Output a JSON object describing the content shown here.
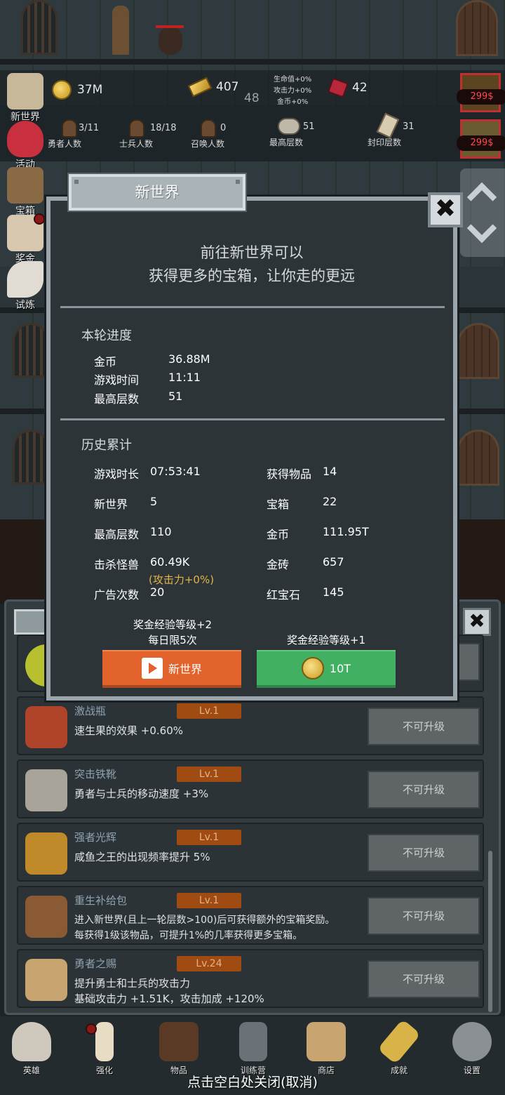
{
  "hud": {
    "gold": "37M",
    "gold_bars": "407",
    "bar_count_small": "48",
    "buffs": [
      "生命值+0%",
      "攻击力+0%",
      "金币+0%"
    ],
    "rubies": "42",
    "heroes_value": "3/11",
    "heroes_label": "勇者人数",
    "soldiers_value": "18/18",
    "soldiers_label": "士兵人数",
    "summons_value": "0",
    "summons_label": "召唤人数",
    "max_floor_value": "51",
    "max_floor_label": "最高层数",
    "sealed_value": "31",
    "sealed_label": "封印层数"
  },
  "side_menu": [
    "新世界",
    "活动",
    "宝箱",
    "奖金",
    "试炼"
  ],
  "offers": [
    "299$",
    "299$"
  ],
  "dialog": {
    "title": "新世界",
    "close": "✖",
    "intro_line1": "前往新世界可以",
    "intro_line2": "获得更多的宝箱，让你走的更远",
    "round_title": "本轮进度",
    "round": [
      {
        "label": "金币",
        "value": "36.88M"
      },
      {
        "label": "游戏时间",
        "value": "11:11"
      },
      {
        "label": "最高层数",
        "value": "51"
      }
    ],
    "history_title": "历史累计",
    "history_left": [
      {
        "label": "游戏时长",
        "value": "07:53:41"
      },
      {
        "label": "新世界",
        "value": "5"
      },
      {
        "label": "最高层数",
        "value": "110"
      },
      {
        "label": "击杀怪兽",
        "value": "60.49K"
      },
      {
        "label": "广告次数",
        "value": "20"
      }
    ],
    "attack_note": "(攻击力+0%)",
    "history_right": [
      {
        "label": "获得物品",
        "value": "14"
      },
      {
        "label": "宝箱",
        "value": "22"
      },
      {
        "label": "金币",
        "value": "111.95T"
      },
      {
        "label": "金砖",
        "value": "657"
      },
      {
        "label": "红宝石",
        "value": "145"
      }
    ],
    "ad_reward_line1": "奖金经验等级+2",
    "ad_reward_line2": "每日限5次",
    "coin_reward": "奖金经验等级+1",
    "ad_button": "新世界",
    "coin_button": "10T"
  },
  "upgrades": [
    {
      "name": "激战瓶",
      "level": "Lv.1",
      "desc1": "速生果的效果 +0.60%",
      "desc2": "",
      "button": "不可升级",
      "color": "#b0442a"
    },
    {
      "name": "突击铁靴",
      "level": "Lv.1",
      "desc1": "勇者与士兵的移动速度 +3%",
      "desc2": "",
      "button": "不可升级",
      "color": "#a8a49a"
    },
    {
      "name": "强者光辉",
      "level": "Lv.1",
      "desc1": "咸鱼之王的出现频率提升 5%",
      "desc2": "",
      "button": "不可升级",
      "color": "#c08a2a"
    },
    {
      "name": "重生补给包",
      "level": "Lv.1",
      "desc1": "进入新世界(且上一轮层数>100)后可获得额外的宝箱奖励。",
      "desc2": "每获得1级该物品，可提升1%的几率获得更多宝箱。",
      "button": "不可升级",
      "color": "#8a5a34"
    },
    {
      "name": "勇者之赐",
      "level": "Lv.24",
      "desc1": "提升勇士和士兵的攻击力",
      "desc2": "基础攻击力 +1.51K，攻击加成 +120%",
      "button": "不可升级",
      "color": "#c8a470"
    }
  ],
  "nav": [
    "英雄",
    "强化",
    "物品",
    "训练营",
    "商店",
    "成就",
    "设置"
  ],
  "close_hint": "点击空白处关闭(取消)"
}
